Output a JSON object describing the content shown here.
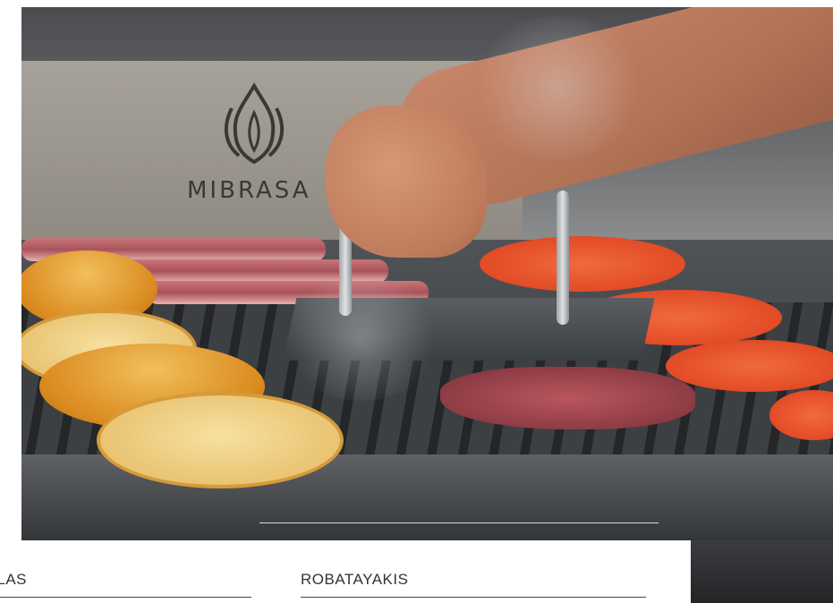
{
  "hero": {
    "brand_text": "MIBRASA"
  },
  "tabs": [
    {
      "label": "LAS"
    },
    {
      "label": "ROBATAYAKIS"
    }
  ]
}
